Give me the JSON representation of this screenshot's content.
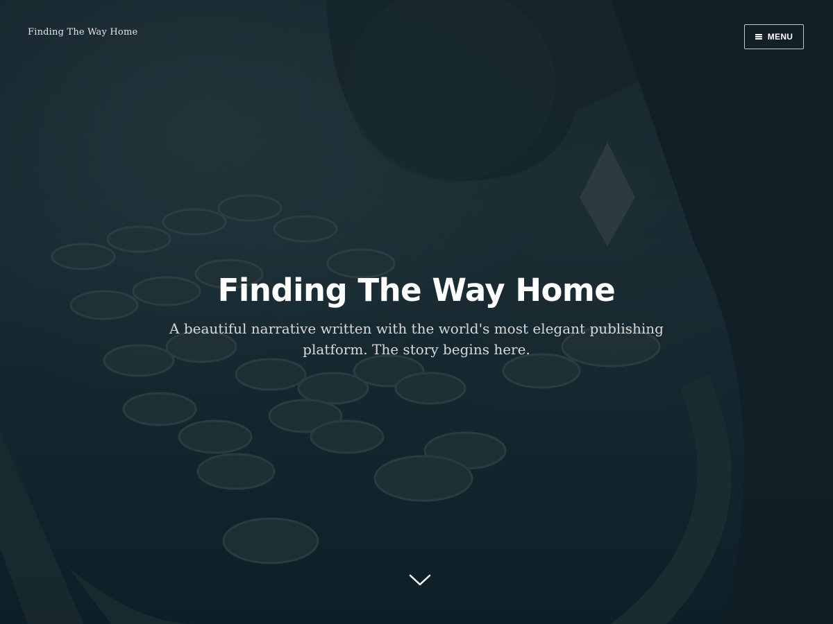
{
  "header": {
    "site_title": "Finding The Way Home",
    "menu_label": "MENU",
    "menu_icon": "hamburger-icon"
  },
  "hero": {
    "title": "Finding The Way Home",
    "tagline": "A beautiful narrative written with the world's most elegant publishing platform. The story begins here.",
    "scroll_icon": "chevron-down-icon",
    "background_image": "vintage typewriter keys"
  },
  "colors": {
    "overlay": "#0c202a",
    "text": "#ffffff"
  }
}
